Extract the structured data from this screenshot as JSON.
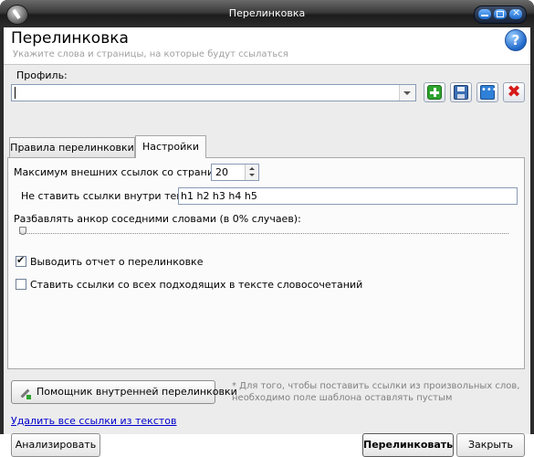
{
  "window": {
    "title": "Перелинковка"
  },
  "header": {
    "title": "Перелинковка",
    "subtitle": "Укажите слова и страницы, на которые будут ссылаться"
  },
  "profile": {
    "label": "Профиль:",
    "value": ""
  },
  "tabs": [
    {
      "label": "Правила перелинковки",
      "active": false
    },
    {
      "label": "Настройки",
      "active": true
    }
  ],
  "settings": {
    "max_links_label": "Максимум внешних ссылок со страницы:",
    "max_links_value": "20",
    "no_links_tags_label": "Не ставить ссылки внутри тегов:",
    "no_links_tags_value": "h1 h2 h3 h4 h5",
    "dilute_label": "Разбавлять анкор соседними словами  (в 0% случаев):",
    "dilute_percent": 0,
    "report_label": "Выводить отчет о перелинковке",
    "report_checked": true,
    "all_phrases_label": "Ставить ссылки со всех подходящих в тексте словосочетаний",
    "all_phrases_checked": false
  },
  "assistant_button": "Помощник внутренней перелинковки",
  "note": "* Для того, чтобы поставить ссылки из произвольных слов, необходимо поле шаблона оставлять пустым",
  "delete_link": "Удалить все ссылки из текстов",
  "footer": {
    "analyze": "Анализировать",
    "link": "Перелинковать",
    "close": "Закрыть"
  },
  "colors": {
    "link": "#0000cc",
    "title_bar": "#2b2b2b",
    "panel": "#ececec"
  }
}
